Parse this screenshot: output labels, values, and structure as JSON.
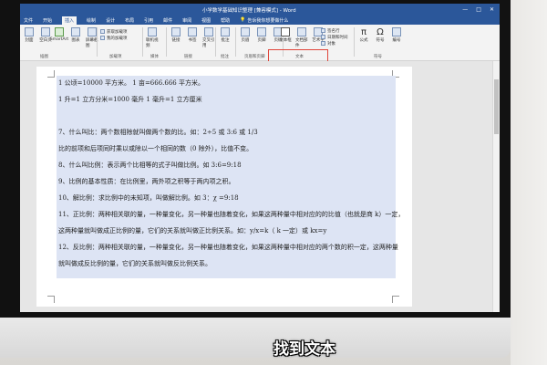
{
  "window": {
    "title": "小学数学基础知识整理 [兼容模式] - Word",
    "controls": [
      "—",
      "□",
      "✕"
    ]
  },
  "menu": {
    "tabs": [
      "文件",
      "开始",
      "插入",
      "绘制",
      "设计",
      "布局",
      "引用",
      "邮件",
      "审阅",
      "视图",
      "帮助"
    ],
    "active_index": 2,
    "search_hint": "告诉我你想要做什么"
  },
  "ribbon": {
    "pages_group": {
      "label": "页面",
      "buttons": [
        "封面",
        "空白页",
        "分页"
      ]
    },
    "table_group": {
      "label": "表格",
      "buttons": [
        "表格"
      ]
    },
    "illus_group": {
      "label": "插图",
      "buttons": [
        "图片",
        "联机图片",
        "形状",
        "图标",
        "3D模型",
        "SmartArt",
        "图表",
        "屏幕截图"
      ]
    },
    "addins_group": {
      "label": "加载项",
      "items": [
        "获取加载项",
        "我的加载项"
      ]
    },
    "media_group": {
      "label": "媒体",
      "buttons": [
        "联机视频"
      ]
    },
    "links_group": {
      "label": "链接",
      "buttons": [
        "链接",
        "书签",
        "交叉引用"
      ]
    },
    "comments_group": {
      "label": "批注",
      "buttons": [
        "批注"
      ]
    },
    "hf_group": {
      "label": "页眉和页脚",
      "buttons": [
        "页眉",
        "页脚",
        "页码"
      ]
    },
    "text_group": {
      "label": "文本",
      "buttons": [
        "文本框",
        "文档部件",
        "艺术字",
        "首字下沉"
      ],
      "small": [
        "签名行",
        "日期和时间",
        "对象"
      ]
    },
    "symbols_group": {
      "label": "符号",
      "buttons": [
        "公式",
        "符号",
        "编号"
      ]
    }
  },
  "document": {
    "lines": [
      "1 公顷=10000 平方米。  1 亩=666.666 平方米。",
      "1 升=1 立方分米=1000 毫升  1 毫升=1 立方厘米",
      "7、什么叫比：两个数相除就叫做两个数的比。如：2÷5 或 3:6 或 1/3",
      "比的前项和后项同时乘以或除以一个相同的数（0 除外），比值不变。",
      "8、什么叫比例：表示两个比相等的式子叫做比例。如 3:6=9:18",
      "9、比例的基本性质：在比例里，两外项之积等于两内项之积。",
      "10、解比例：求比例中的未知项，叫做解比例。如 3：χ =9:18",
      "11、正比例：两种相关联的量，一种量变化，另一种量也随着变化，如果这两种量中相对应的的比值（也就是商 k）一定，",
      "这两种量就叫做成正比例的量，它们的关系就叫做正比例关系。如：y/x=k（ k 一定）或 kx=y",
      "12、反比例：两种相关联的量，一种量变化，另一种量也随着变化，如果这两种量中相对应的两个数的积一定，这两种量",
      "就叫做成反比例的量，它们的关系就叫做反比例关系。"
    ]
  },
  "caption": "找到文本"
}
